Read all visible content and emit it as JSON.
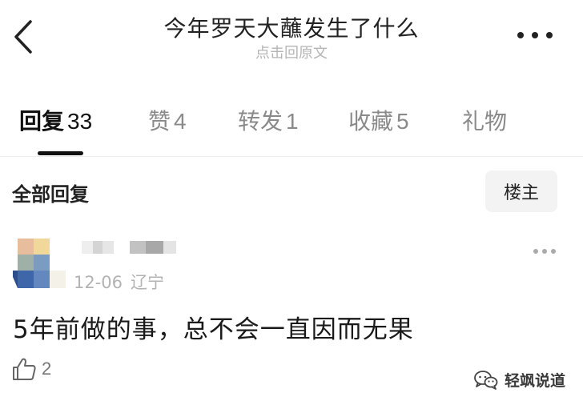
{
  "header": {
    "title": "今年罗天大蘸发生了什么",
    "subtitle": "点击回原文"
  },
  "tabs": [
    {
      "label": "回复",
      "count": "33",
      "active": true
    },
    {
      "label": "赞",
      "count": "4",
      "active": false
    },
    {
      "label": "转发",
      "count": "1",
      "active": false
    },
    {
      "label": "收藏",
      "count": "5",
      "active": false
    },
    {
      "label": "礼物",
      "count": "",
      "active": false
    }
  ],
  "replies_bar": {
    "title": "全部回复",
    "owner_button": "楼主"
  },
  "comment": {
    "date": "12-06",
    "location": "辽宁",
    "text": "5年前做的事，总不会一直因而无果",
    "like_count": "2"
  },
  "watermark": {
    "text": "轻飒说道"
  },
  "icons": {
    "back": "chevron-left-icon",
    "more": "more-horizontal-icon",
    "like": "thumbs-up-icon",
    "watermark": "wechat-icon"
  },
  "colors": {
    "text_primary": "#1a1a1a",
    "text_secondary": "#8a8a8a",
    "subtitle": "#b5b5b5",
    "button_bg": "#f3f3f3",
    "divider": "#ededed"
  }
}
